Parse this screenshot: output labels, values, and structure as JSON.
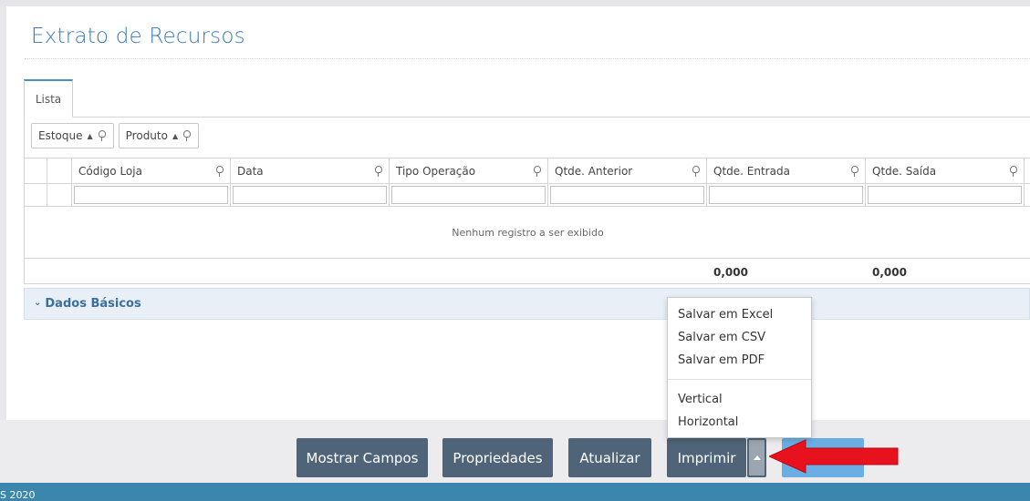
{
  "page": {
    "title": "Extrato de Recursos"
  },
  "tabs": [
    {
      "label": "Lista"
    }
  ],
  "group_chips": [
    {
      "label": "Estoque",
      "sort_icon": "sort-asc-icon",
      "pin_icon": "pin-icon"
    },
    {
      "label": "Produto",
      "sort_icon": "sort-asc-icon",
      "pin_icon": "pin-icon"
    }
  ],
  "grid": {
    "columns": [
      {
        "label": "Código Loja"
      },
      {
        "label": "Data"
      },
      {
        "label": "Tipo Operação"
      },
      {
        "label": "Qtde. Anterior"
      },
      {
        "label": "Qtde. Entrada"
      },
      {
        "label": "Qtde. Saída"
      }
    ],
    "filter_values": [
      "",
      "",
      "",
      "",
      "",
      ""
    ],
    "empty_message": "Nenhum registro a ser exibido",
    "totals": {
      "qtde_entrada": "0,000",
      "qtde_saida": "0,000"
    }
  },
  "section": {
    "label": "Dados Básicos",
    "icon": "chevron-down-icon"
  },
  "footer": {
    "buttons": {
      "mostrar_campos": "Mostrar Campos",
      "propriedades": "Propriedades",
      "atualizar": "Atualizar",
      "imprimir": "Imprimir"
    }
  },
  "print_menu": {
    "items": [
      "Salvar em Excel",
      "Salvar em CSV",
      "Salvar em PDF",
      "Vertical",
      "Horizontal"
    ]
  },
  "status_bar": {
    "text": "S 2020"
  },
  "colors": {
    "title": "#3a78b5",
    "button_bg": "#4f6478",
    "status_bar": "#3b86ad",
    "section_bg": "#e8eff7",
    "annotation_arrow": "#e8121f"
  }
}
